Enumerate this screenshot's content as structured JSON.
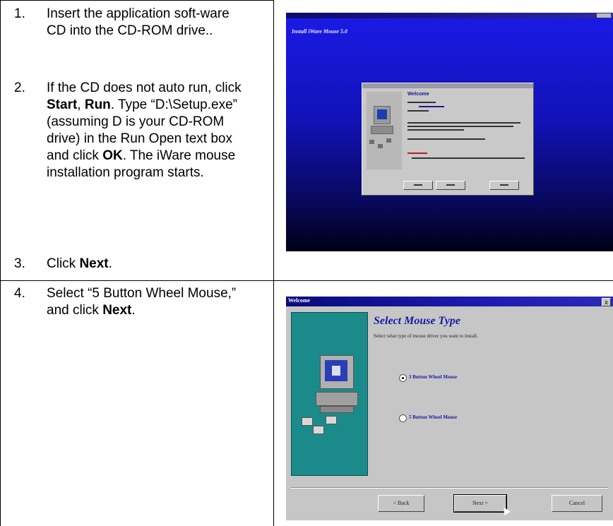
{
  "steps": [
    {
      "num": "1.",
      "text": "Insert the application soft-ware CD into the CD-ROM drive.."
    },
    {
      "num": "2.",
      "pre": "If the CD does not auto run, click ",
      "b1": "Start",
      "sep": ", ",
      "b2": "Run",
      "mid": ". Type “D:\\Setup.exe” (assuming D is your CD-ROM drive) in the Run Open text box and click ",
      "b3": "OK",
      "post": ". The iWare mouse installation program starts."
    },
    {
      "num": "3.",
      "pre": "Click ",
      "b1": "Next",
      "post": "."
    },
    {
      "num": "4.",
      "pre": "Select “5 Button Wheel Mouse,” and click ",
      "b1": "Next",
      "post": "."
    }
  ],
  "screenshot1": {
    "window_title": "Install iWare Mouse 5.0",
    "dialog_heading": "Welcome"
  },
  "screenshot2": {
    "window_title": "Welcome",
    "close_glyph": "x",
    "heading": "Select Mouse Type",
    "subtitle": "Select what type of mouse driver you want to install.",
    "options": [
      {
        "label": "3 Button Wheel Mouse",
        "selected": true
      },
      {
        "label": "5 Button Wheel Mouse",
        "selected": false
      }
    ],
    "buttons": {
      "back": "< Back",
      "next": "Next >",
      "cancel": "Cancel"
    },
    "panel_color": "#1b8a8a",
    "titlebar_color": "#0a0a7a",
    "heading_color": "#1a1aa0"
  },
  "colors": {
    "splash_top": "#1a1ae6",
    "splash_bottom": "#000014"
  },
  "icons": [
    "computer-icon",
    "floppy-disk-icon",
    "radio-button-icon",
    "close-icon",
    "mouse-cursor-icon"
  ]
}
